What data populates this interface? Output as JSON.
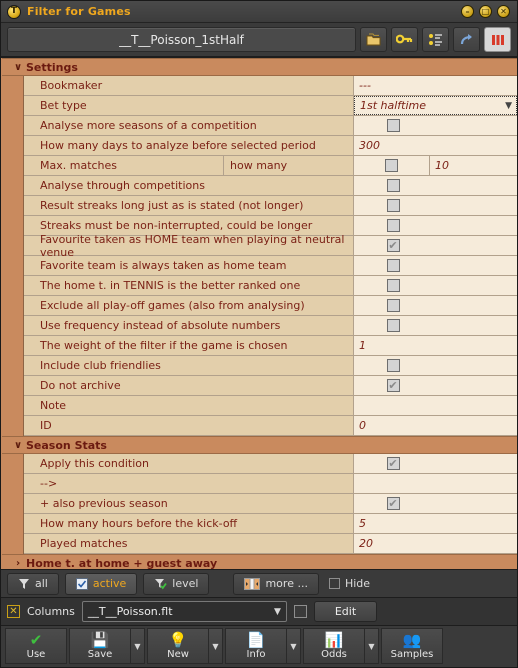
{
  "window": {
    "title": "Filter for Games",
    "logo_text": "T",
    "controls": [
      {
        "name": "minimize",
        "glyph": "–"
      },
      {
        "name": "maximize",
        "glyph": "□"
      },
      {
        "name": "close",
        "glyph": "✕"
      }
    ]
  },
  "header": {
    "filter_name": "__T__Poisson_1stHalf",
    "buttons": [
      {
        "name": "open-folder-icon",
        "glyph": "📁"
      },
      {
        "name": "key-icon",
        "glyph": "🔑"
      },
      {
        "name": "tree-list-icon",
        "glyph": "☲"
      },
      {
        "name": "redo-arrow-icon",
        "glyph": "↷"
      },
      {
        "name": "bars-icon",
        "glyph": "‖"
      }
    ]
  },
  "sections": [
    {
      "title": "Settings",
      "expanded": true,
      "chevron": "∨",
      "rows": [
        {
          "label": "Bookmaker",
          "value": "---",
          "kind": "value"
        },
        {
          "label": "Bet type",
          "value": "1st halftime",
          "kind": "dropdown"
        },
        {
          "label": "Analyse more seasons of a competition",
          "kind": "checkbox",
          "checked": false
        },
        {
          "label": "How many days to analyze before selected period",
          "value": "300",
          "kind": "value"
        },
        {
          "label": "Max. matches",
          "sub": "how many",
          "kind": "checkbox-value",
          "checked": false,
          "value": "10"
        },
        {
          "label": "Analyse through competitions",
          "kind": "checkbox",
          "checked": false
        },
        {
          "label": "Result streaks long just as is stated (not longer)",
          "kind": "checkbox",
          "checked": false
        },
        {
          "label": "Streaks must be non-interrupted, could be longer",
          "kind": "checkbox",
          "checked": false
        },
        {
          "label": "Favourite taken as HOME team when playing at neutral venue",
          "kind": "checkbox",
          "checked": true
        },
        {
          "label": "Favorite team is always taken as home team",
          "kind": "checkbox",
          "checked": false
        },
        {
          "label": "The home t. in TENNIS is the better ranked one",
          "kind": "checkbox",
          "checked": false
        },
        {
          "label": "Exclude all play-off games (also from analysing)",
          "kind": "checkbox",
          "checked": false
        },
        {
          "label": "Use frequency instead of absolute numbers",
          "kind": "checkbox",
          "checked": false
        },
        {
          "label": "The weight of the filter if the game is chosen",
          "value": "1",
          "kind": "value"
        },
        {
          "label": "Include club friendlies",
          "kind": "checkbox",
          "checked": false
        },
        {
          "label": "Do not archive",
          "kind": "checkbox",
          "checked": true
        },
        {
          "label": "Note",
          "value": "",
          "kind": "value"
        },
        {
          "label": "ID",
          "value": "0",
          "kind": "value"
        }
      ]
    },
    {
      "title": "Season Stats",
      "expanded": true,
      "chevron": "∨",
      "rows": [
        {
          "label": "Apply this condition",
          "kind": "checkbox",
          "checked": true
        },
        {
          "label": "-->",
          "value": "",
          "kind": "value"
        },
        {
          "label": "+ also previous season",
          "kind": "checkbox",
          "checked": true
        },
        {
          "label": "How many hours before the kick-off",
          "value": "5",
          "kind": "value"
        },
        {
          "label": "Played matches",
          "value": "20",
          "kind": "value"
        }
      ]
    },
    {
      "title": "Home t. at home + guest away",
      "expanded": false,
      "chevron": "›",
      "rows": []
    }
  ],
  "filter_bar": {
    "all_label": "all",
    "active_label": "active",
    "level_label": "level",
    "more_label": "more ...",
    "hide_label": "Hide",
    "hide_checked": false,
    "active_selected": true
  },
  "columns_bar": {
    "x_glyph": "✕",
    "columns_label": "Columns",
    "file_value": "__T__Poisson.flt",
    "edit_label": "Edit",
    "checkbox_checked": false
  },
  "actions": [
    {
      "label": "Use",
      "icon": "✔",
      "color": "#3fbf3f",
      "has_arrow": false
    },
    {
      "label": "Save",
      "icon": "💾",
      "color": "#e8e8e8",
      "has_arrow": true
    },
    {
      "label": "New",
      "icon": "💡",
      "color": "#f5d431",
      "has_arrow": true
    },
    {
      "label": "Info",
      "icon": "📄",
      "color": "#ede4cf",
      "has_arrow": true
    },
    {
      "label": "Odds",
      "icon": "📊",
      "color": "#e8b32a",
      "has_arrow": true
    },
    {
      "label": "Samples",
      "icon": "👥",
      "color": "#e0c040",
      "has_arrow": false
    }
  ],
  "colors": {
    "accent_orange": "#c98a5e",
    "row_label_bg": "#e3cfab",
    "row_value_bg": "#f6ebda",
    "text_maroon": "#7a1f14",
    "title_gold": "#f0a81e"
  }
}
